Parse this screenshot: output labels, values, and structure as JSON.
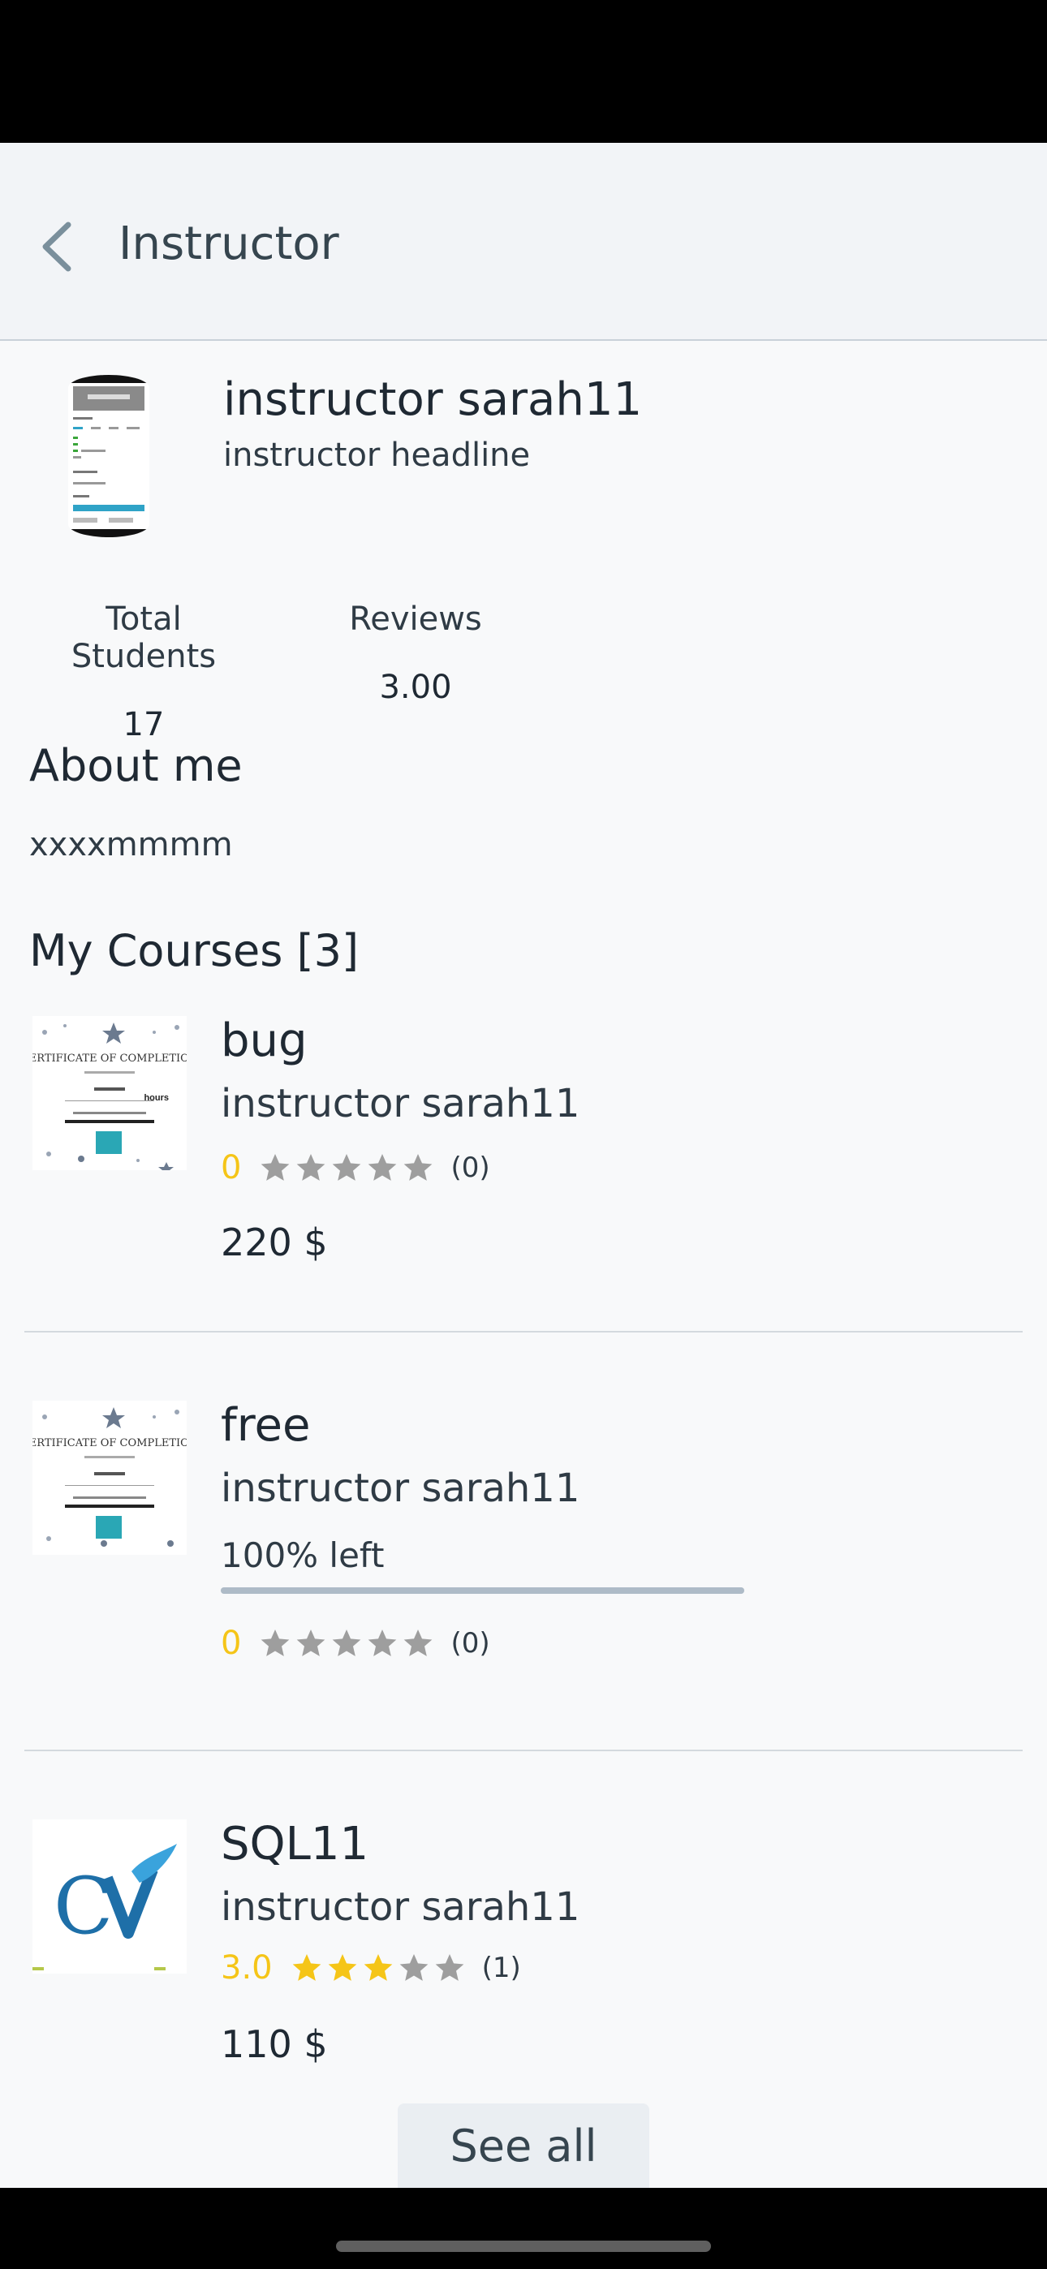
{
  "app_bar": {
    "title": "Instructor"
  },
  "profile": {
    "name": "instructor sarah11",
    "headline": "instructor headline",
    "stats": {
      "students_label": "Total Students",
      "students_value": "17",
      "reviews_label": "Reviews",
      "reviews_value": "3.00"
    }
  },
  "about": {
    "title": "About me",
    "text": "xxxxmmmm"
  },
  "courses": {
    "title": "My Courses [3]",
    "items": [
      {
        "title": "bug",
        "author": "instructor sarah11",
        "rating": "0",
        "stars_filled": 0,
        "reviews": "(0)",
        "price": "220 $",
        "thumbnail": "certificate-image",
        "cert_title": "CERTIFICATE OF COMPLETION",
        "cert_hours": "hours"
      },
      {
        "title": "free",
        "author": "instructor sarah11",
        "progress_text": "100% left",
        "progress_fraction": 1.0,
        "rating": "0",
        "stars_filled": 0,
        "reviews": "(0)",
        "thumbnail": "certificate-image",
        "cert_title": "CERTIFICATE OF COMPLETION"
      },
      {
        "title": "SQL11",
        "author": "instructor sarah11",
        "rating": "3.0",
        "stars_filled": 3,
        "reviews": "(1)",
        "price": "110 $",
        "thumbnail": "cv-logo-image"
      }
    ],
    "see_all_label": "See all"
  },
  "colors": {
    "rating_accent": "#f5c518",
    "star_empty": "#9e9e9e",
    "progress_bar": "#aebbc7"
  },
  "icons": {
    "back": "chevron-left-icon",
    "star": "star-icon"
  }
}
